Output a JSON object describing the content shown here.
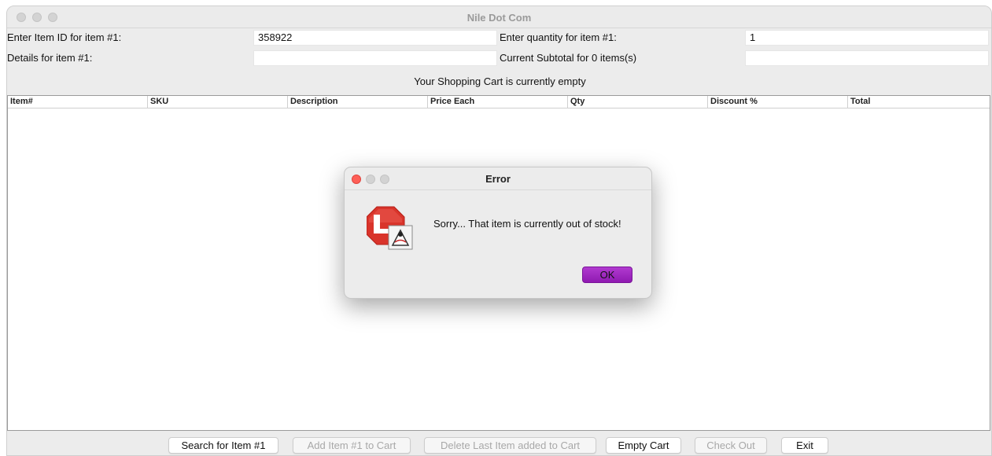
{
  "window": {
    "title": "Nile Dot Com"
  },
  "form": {
    "item_id_label": "Enter Item ID for item #1:",
    "item_id_value": "358922",
    "quantity_label": "Enter quantity for item #1:",
    "quantity_value": "1",
    "details_label": "Details for item #1:",
    "details_value": "",
    "subtotal_label": "Current Subtotal for 0 items(s)",
    "subtotal_value": ""
  },
  "cart_status": "Your Shopping Cart is currently empty",
  "table": {
    "columns": [
      "Item#",
      "SKU",
      "Description",
      "Price Each",
      "Qty",
      "Discount %",
      "Total"
    ]
  },
  "buttons": {
    "search": "Search for Item #1",
    "add": "Add Item #1 to Cart",
    "delete": "Delete Last Item added to Cart",
    "empty": "Empty Cart",
    "checkout": "Check Out",
    "exit": "Exit"
  },
  "dialog": {
    "title": "Error",
    "message": "Sorry... That item is currently out of stock!",
    "ok_label": "OK",
    "icon": "stop-sign-java-icon"
  },
  "colors": {
    "ok_button": "#9b24bd",
    "stop_sign": "#d9342b",
    "close_button": "#fe5f57"
  }
}
